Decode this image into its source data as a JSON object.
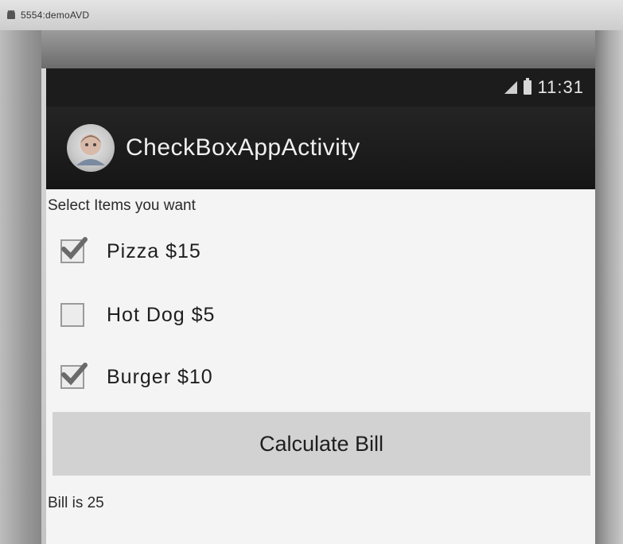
{
  "window": {
    "title": "5554:demoAVD"
  },
  "statusbar": {
    "time": "11:31"
  },
  "actionbar": {
    "title": "CheckBoxAppActivity"
  },
  "content": {
    "prompt": "Select Items you want",
    "items": [
      {
        "label": "Pizza  $15",
        "checked": true
      },
      {
        "label": "Hot Dog  $5",
        "checked": false
      },
      {
        "label": "Burger  $10",
        "checked": true
      }
    ],
    "calculate_label": "Calculate Bill",
    "result": "Bill is 25"
  },
  "colors": {
    "statusbar": "#1c1c1c",
    "actionbar": "#1f1f1f",
    "background": "#f4f4f4",
    "button": "#d2d2d2",
    "check": "#6a6a6a"
  }
}
